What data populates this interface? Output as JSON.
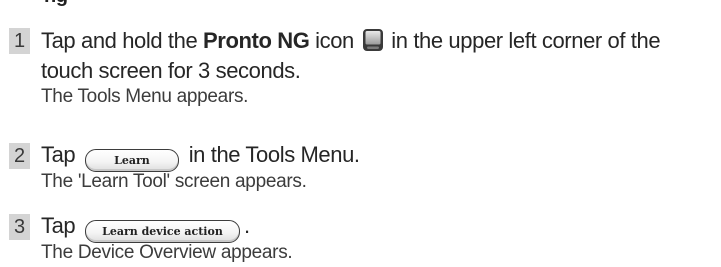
{
  "heading_fragment": "ng",
  "steps": [
    {
      "number": "1",
      "text_before": "Tap and hold the ",
      "bold_text": "Pronto NG",
      "text_middle": " icon ",
      "icon": "pronto-device-icon",
      "text_after": " in the upper left corner of the",
      "line2": "touch screen for 3 seconds.",
      "result": "The Tools Menu appears."
    },
    {
      "number": "2",
      "text_before": "Tap ",
      "button_label": "Learn",
      "text_after": " in the Tools Menu.",
      "result": "The 'Learn Tool' screen appears."
    },
    {
      "number": "3",
      "text_before": "Tap ",
      "button_label": "Learn device action",
      "text_after": ".",
      "result": "The Device Overview appears."
    }
  ]
}
